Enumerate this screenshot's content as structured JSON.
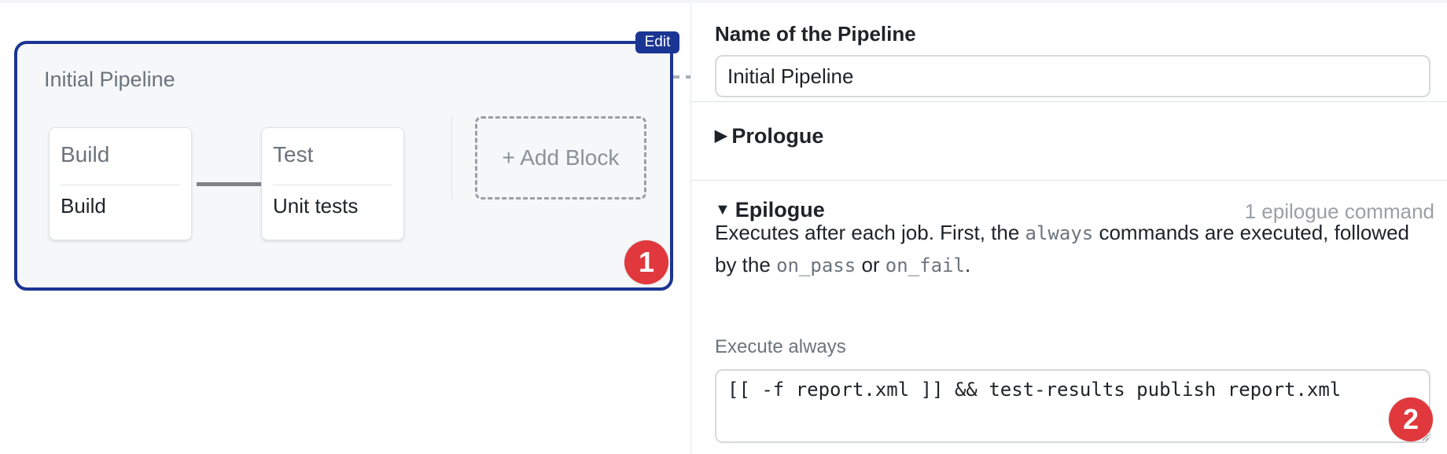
{
  "canvas": {
    "pipeline": {
      "title": "Initial Pipeline",
      "edit_label": "Edit",
      "blocks": [
        {
          "name": "Build",
          "jobs": [
            "Build"
          ]
        },
        {
          "name": "Test",
          "jobs": [
            "Unit tests"
          ]
        }
      ],
      "add_block_label": "+ Add Block"
    },
    "annotation_badge": "1"
  },
  "panel": {
    "name_field": {
      "label": "Name of the Pipeline",
      "value": "Initial Pipeline"
    },
    "prologue": {
      "label": "Prologue",
      "expanded": false,
      "toggle_icon": "triangle-right"
    },
    "epilogue": {
      "label": "Epilogue",
      "expanded": true,
      "toggle_icon": "triangle-down",
      "count_label": "1 epilogue command",
      "description": {
        "part1": "Executes after each job. First, the ",
        "code1": "always",
        "part2": " commands are executed, followed by the ",
        "code2": "on_pass",
        "part3": " or ",
        "code3": "on_fail",
        "part4": "."
      },
      "execute_always_label": "Execute always",
      "execute_always_value": "[[ -f report.xml ]] && test-results publish report.xml"
    },
    "annotation_badge": "2"
  },
  "colors": {
    "pipeline_border": "#1a3593",
    "badge": "#e0383c",
    "muted_text": "#6b747c"
  }
}
